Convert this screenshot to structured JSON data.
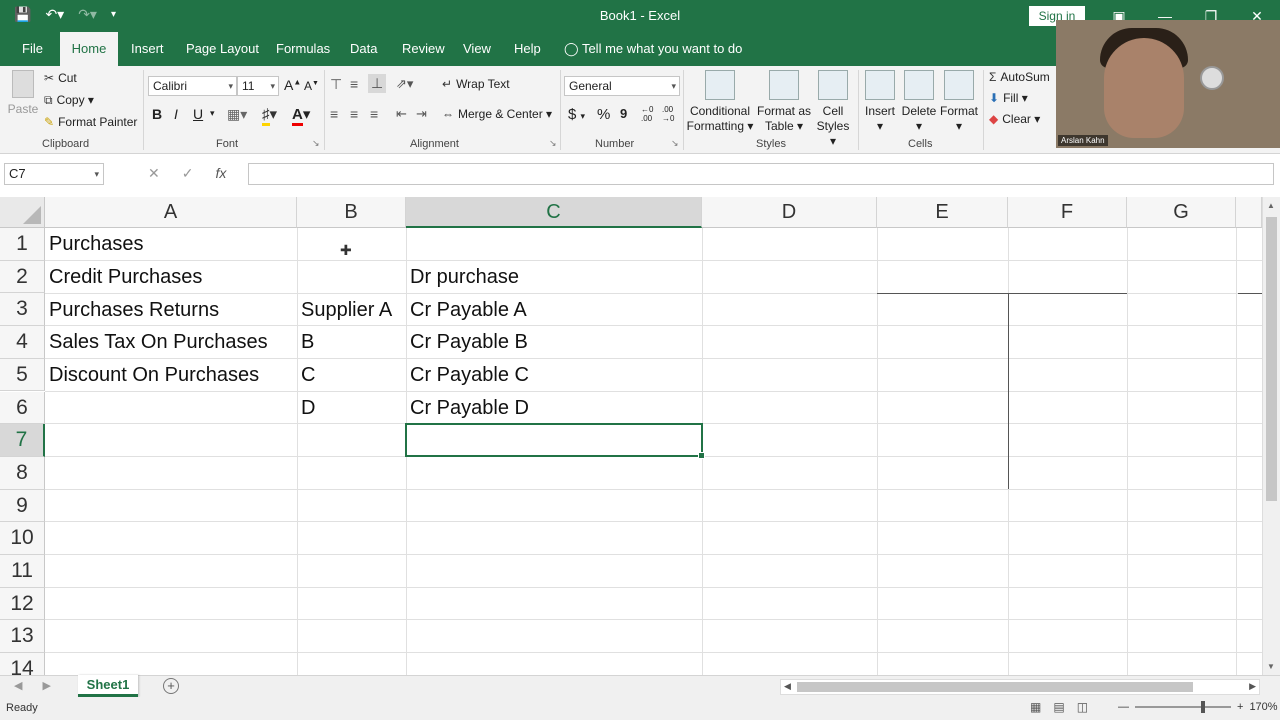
{
  "app": {
    "title": "Book1  -  Excel",
    "sign_in": "Sign in",
    "window_buttons": [
      "ribbon-display-icon",
      "minimize-icon",
      "restore-icon",
      "close-icon"
    ]
  },
  "quick_access": {
    "icons": [
      "save-icon",
      "undo-icon",
      "redo-icon",
      "customize-icon"
    ]
  },
  "menu_tabs": [
    "File",
    "Home",
    "Insert",
    "Page Layout",
    "Formulas",
    "Data",
    "Review",
    "View",
    "Help"
  ],
  "tell_me": "Tell me what you want to do",
  "ribbon": {
    "clipboard": {
      "label": "Clipboard",
      "paste": "Paste",
      "cut": "Cut",
      "copy": "Copy",
      "format_painter": "Format Painter"
    },
    "font": {
      "label": "Font",
      "font_name": "Calibri",
      "font_size": "11",
      "bold": "B",
      "italic": "I",
      "underline": "U"
    },
    "alignment": {
      "label": "Alignment",
      "wrap_text": "Wrap Text",
      "merge_center": "Merge & Center"
    },
    "number": {
      "label": "Number",
      "format": "General",
      "currency": "$",
      "percent": "%",
      "comma": "9"
    },
    "styles": {
      "label": "Styles",
      "conditional": "Conditional Formatting",
      "format_table": "Format as Table",
      "cell_styles": "Cell Styles"
    },
    "cells": {
      "label": "Cells",
      "insert": "Insert",
      "delete": "Delete",
      "format": "Format"
    },
    "editing": {
      "autosum": "AutoSum",
      "fill": "Fill",
      "clear": "Clear"
    }
  },
  "webcam": {
    "caption": "Arslan Kahn"
  },
  "formula_bar": {
    "name_box": "C7",
    "fx": "fx",
    "value": ""
  },
  "sheet": {
    "columns": [
      "A",
      "B",
      "C",
      "D",
      "E",
      "F",
      "G"
    ],
    "selected_column": "C",
    "rows": [
      "1",
      "2",
      "3",
      "4",
      "5",
      "6",
      "7",
      "8",
      "9",
      "10",
      "11",
      "12",
      "13",
      "14"
    ],
    "selected_row": "7",
    "cells": {
      "A1": "Purchases",
      "A2": "Credit Purchases",
      "A3": "Purchases Returns",
      "A4": "Sales Tax On Purchases",
      "A5": "Discount On Purchases",
      "B3": "Supplier A",
      "B4": "B",
      "B5": "C",
      "B6": "D",
      "C2": "Dr purchase",
      "C3": "Cr Payable A",
      "C4": "Cr Payable B",
      "C5": "Cr Payable C",
      "C6": "Cr Payable D"
    },
    "active_cell": "C7"
  },
  "sheet_tabs": {
    "active": "Sheet1"
  },
  "status": {
    "ready": "Ready",
    "zoom": "170%"
  },
  "colors": {
    "accent": "#217346"
  }
}
